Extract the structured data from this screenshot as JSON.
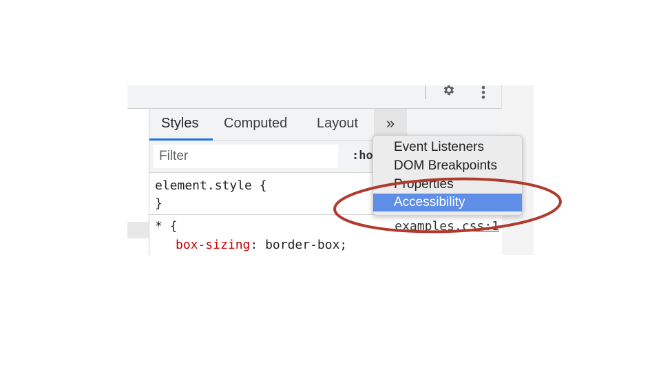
{
  "toolbar": {
    "settings_icon": "gear-icon",
    "more_options_icon": "kebab-vertical-icon"
  },
  "tabs": [
    {
      "label": "Styles",
      "active": true
    },
    {
      "label": "Computed",
      "active": false
    },
    {
      "label": "Layout",
      "active": false
    }
  ],
  "more_tabs_label": "»",
  "filter": {
    "placeholder": "Filter",
    "value": ""
  },
  "pseudo_toggle": ":ho",
  "rules": {
    "element_style_open": "element.style {",
    "element_style_close": "}",
    "universal_selector": "* {",
    "property_name": "box-sizing",
    "property_sep": ": ",
    "property_value": "border-box;",
    "source_link": "examples.css:1"
  },
  "menu": {
    "items": [
      {
        "label": "Event Listeners",
        "selected": false
      },
      {
        "label": "DOM Breakpoints",
        "selected": false
      },
      {
        "label": "Properties",
        "selected": false
      },
      {
        "label": "Accessibility",
        "selected": true
      }
    ],
    "highlight_color": "#5e8ee8"
  },
  "annotation": {
    "shape": "ellipse",
    "color": "#b03a2e",
    "target": "Accessibility"
  }
}
